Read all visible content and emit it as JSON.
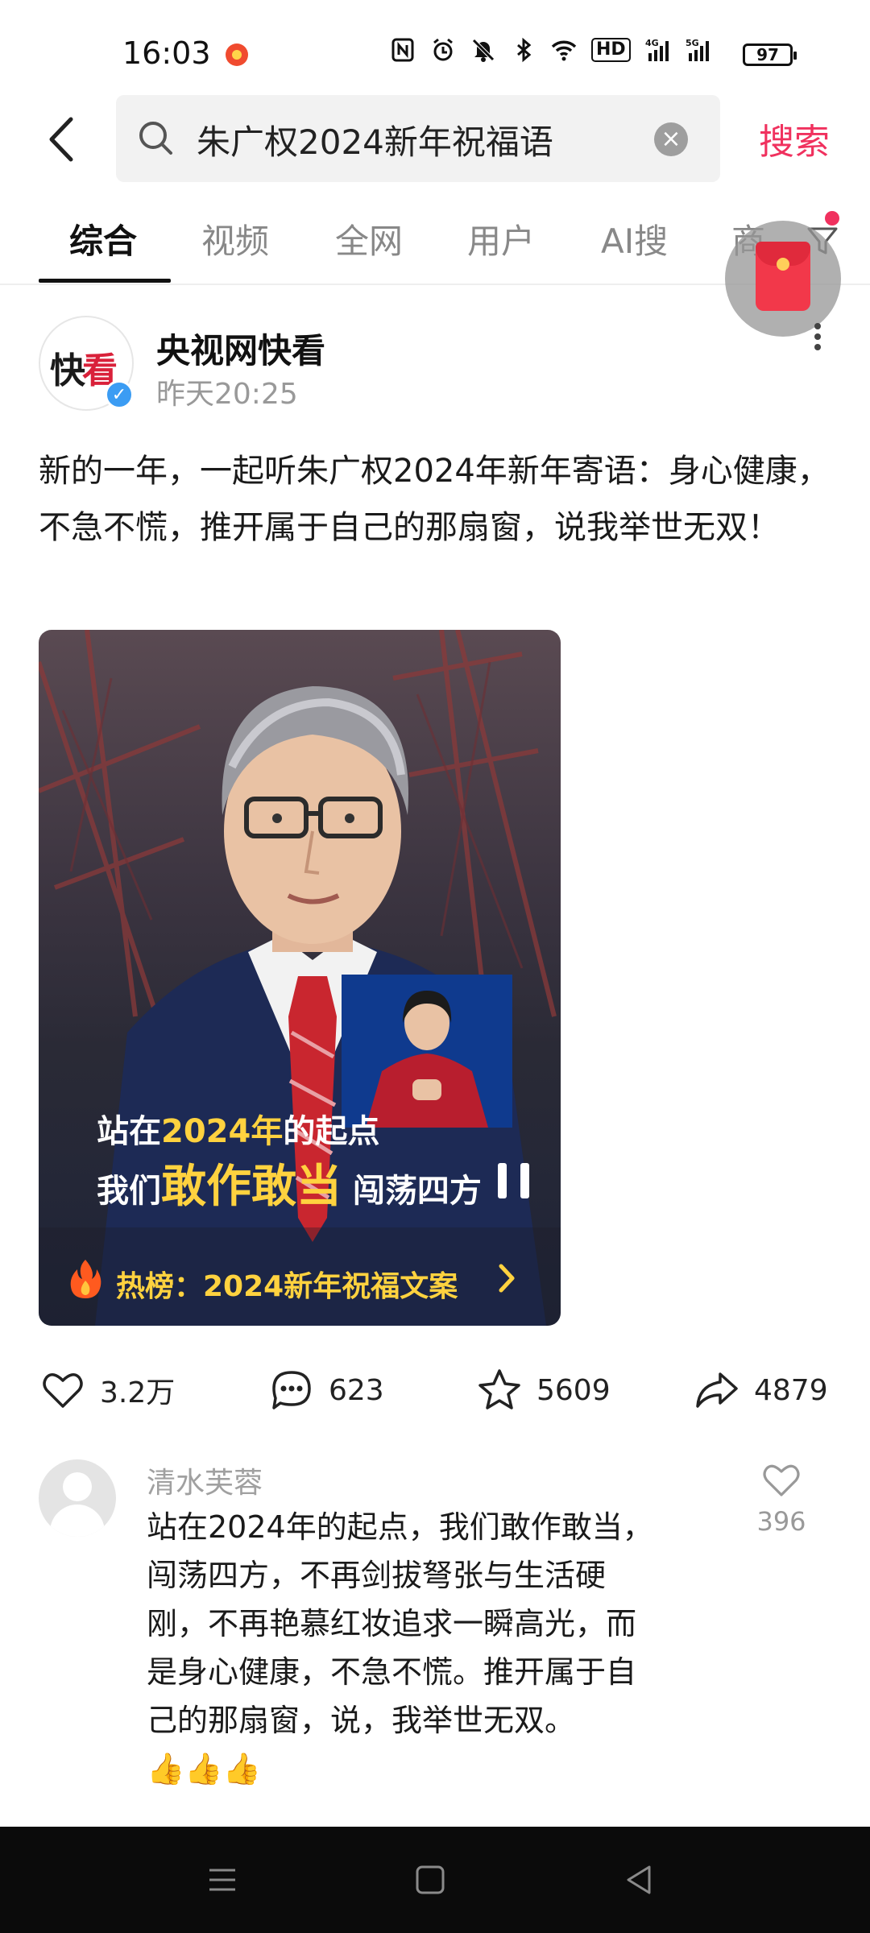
{
  "status": {
    "time": "16:03",
    "network1": "HD",
    "network2": "4G",
    "network3": "5G",
    "battery": "97"
  },
  "search": {
    "query": "朱广权2024新年祝福语",
    "button_label": "搜索"
  },
  "tabs": [
    {
      "label": "综合",
      "active": true
    },
    {
      "label": "视频",
      "active": false
    },
    {
      "label": "全网",
      "active": false
    },
    {
      "label": "用户",
      "active": false
    },
    {
      "label": "AI搜",
      "active": false
    },
    {
      "label": "商",
      "active": false
    }
  ],
  "post": {
    "avatar_text_1": "快",
    "avatar_text_2": "看",
    "author": "央视网快看",
    "time": "昨天20:25",
    "text": "新的一年，一起听朱广权2024年新年寄语：身心健康，不急不慌，推开属于自己的那扇窗，说我举世无双！",
    "video": {
      "caption_line1_a": "站在",
      "caption_line1_b": "2024年",
      "caption_line1_c": "的起点",
      "caption_line2_a": "我们",
      "caption_line2_b": "敢作敢当",
      "caption_line2_c": " 闯荡四方",
      "hot_label": "热榜：2024新年祝福文案"
    },
    "actions": {
      "likes": "3.2万",
      "comments": "623",
      "favorites": "5609",
      "shares": "4879"
    }
  },
  "comment": {
    "user": "清水芙蓉",
    "text": "站在2024年的起点，我们敢作敢当，闯荡四方，不再剑拔弩张与生活硬刚，不再艳慕红妆追求一瞬高光，而是身心健康，不急不慌。推开属于自己的那扇窗，说，我举世无双。",
    "emoji": "👍👍👍",
    "likes": "396"
  },
  "colors": {
    "accent": "#f0315e",
    "video_caption_yellow": "#ffd23f",
    "verified_blue": "#3b9cf3"
  }
}
